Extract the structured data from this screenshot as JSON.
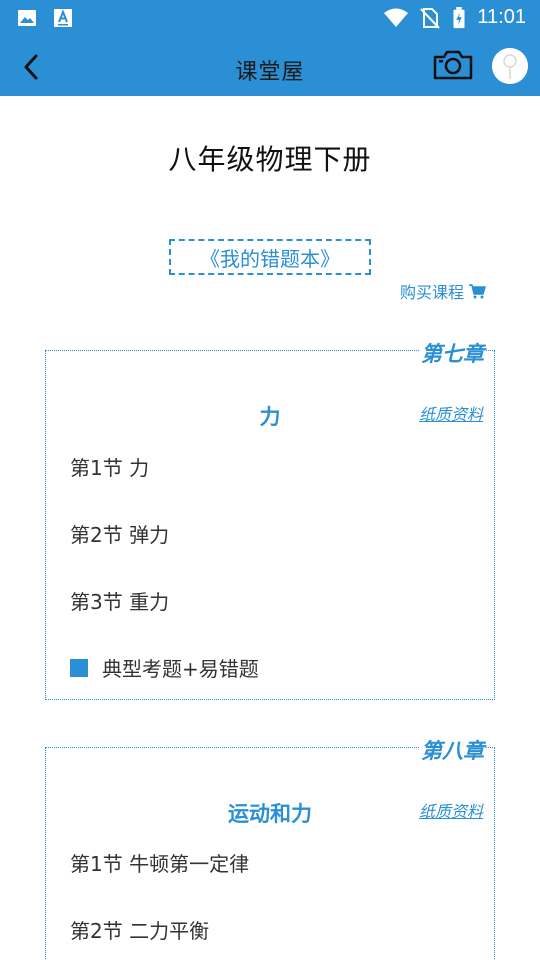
{
  "status_bar": {
    "time": "11:01",
    "left_icons": [
      "gallery-icon",
      "font-app-icon"
    ],
    "right_icons": [
      "wifi-icon",
      "no-sim-icon",
      "battery-charging-icon"
    ]
  },
  "app_bar": {
    "title": "课堂屋",
    "back_icon": "chevron-left-icon",
    "camera_icon": "camera-icon",
    "avatar_icon": "avatar-icon"
  },
  "book": {
    "title": "八年级物理下册",
    "mistake_book_label": "《我的错题本》",
    "buy_label": "购买课程",
    "buy_icon": "cart-icon"
  },
  "chapters": [
    {
      "tag": "第七章",
      "title": "力",
      "paper_label": "纸质资料",
      "sections": [
        "第1节 力",
        "第2节 弹力",
        "第3节 重力"
      ],
      "typical_label": "典型考题+易错题"
    },
    {
      "tag": "第八章",
      "title": "运动和力",
      "paper_label": "纸质资料",
      "sections": [
        "第1节 牛顿第一定律",
        "第2节 二力平衡"
      ]
    }
  ],
  "colors": {
    "accent": "#2a8fd4",
    "background": "#ffffff",
    "text": "#333333"
  }
}
